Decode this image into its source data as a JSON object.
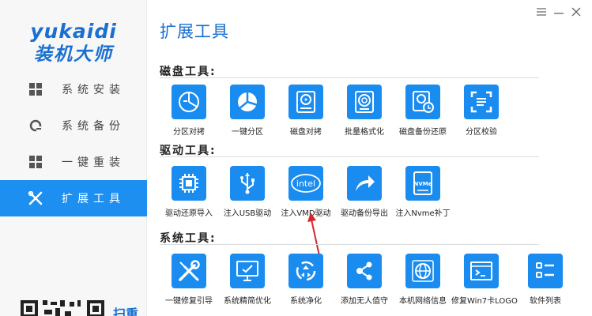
{
  "sidebar": {
    "logo_line1": "yukaidi",
    "logo_line2": "装机大师",
    "items": [
      {
        "label": "系统安装"
      },
      {
        "label": "系统备份"
      },
      {
        "label": "一键重装"
      },
      {
        "label": "扩展工具"
      }
    ],
    "scan_text": "扫重"
  },
  "main": {
    "title": "扩展工具",
    "sections": [
      {
        "title": "磁盘工具:",
        "tools": [
          {
            "label": "分区对拷"
          },
          {
            "label": "一键分区"
          },
          {
            "label": "磁盘对拷"
          },
          {
            "label": "批量格式化"
          },
          {
            "label": "磁盘备份还原"
          },
          {
            "label": "分区校验"
          }
        ]
      },
      {
        "title": "驱动工具:",
        "tools": [
          {
            "label": "驱动还原导入"
          },
          {
            "label": "注入USB驱动"
          },
          {
            "label": "注入VMD驱动",
            "icon_text": "intel"
          },
          {
            "label": "驱动备份导出"
          },
          {
            "label": "注入Nvme补丁",
            "icon_text": "NVMe"
          }
        ]
      },
      {
        "title": "系统工具:",
        "tools": [
          {
            "label": "一键修复引导"
          },
          {
            "label": "系统精简优化"
          },
          {
            "label": "系统净化"
          },
          {
            "label": "添加无人值守"
          },
          {
            "label": "本机网络信息"
          },
          {
            "label": "修复Win7卡LOGO"
          },
          {
            "label": "软件列表"
          }
        ]
      }
    ]
  },
  "colors": {
    "accent": "#1a8cf0",
    "brand": "#1a6fd1",
    "arrow": "#d9262c"
  }
}
